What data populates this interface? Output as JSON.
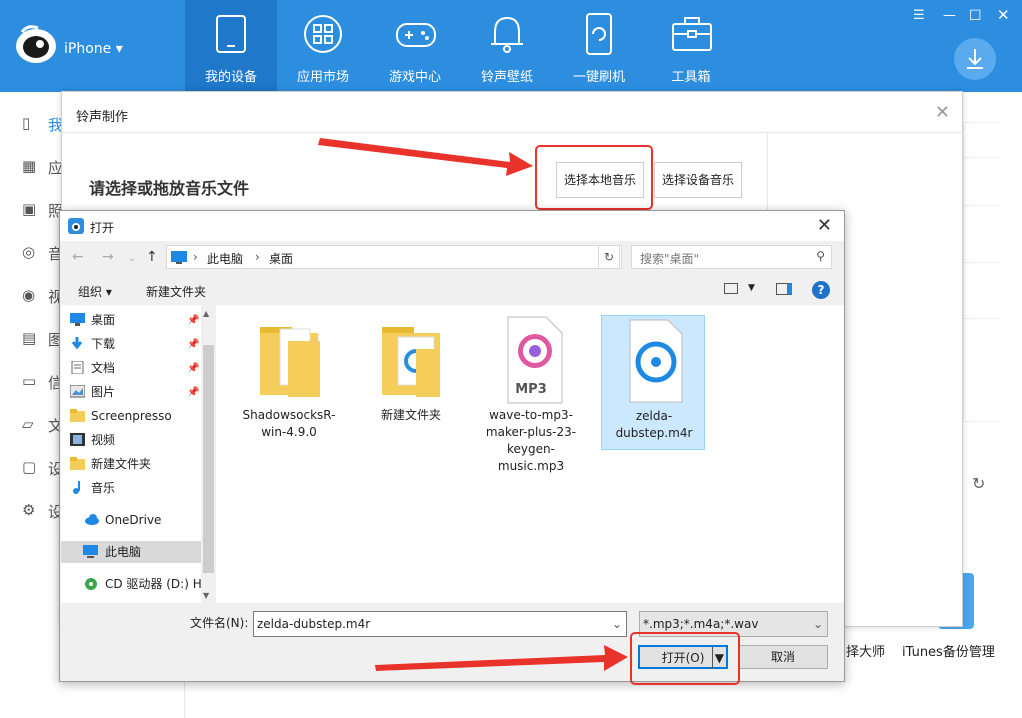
{
  "app": {
    "device": "iPhone ▾"
  },
  "nav": [
    {
      "label": "我的设备"
    },
    {
      "label": "应用市场"
    },
    {
      "label": "游戏中心"
    },
    {
      "label": "铃声壁纸"
    },
    {
      "label": "一键刷机"
    },
    {
      "label": "工具箱"
    }
  ],
  "sidebar": {
    "items": [
      {
        "label": "我"
      },
      {
        "label": "应"
      },
      {
        "label": "照"
      },
      {
        "label": "音"
      },
      {
        "label": "视"
      },
      {
        "label": "图"
      },
      {
        "label": "信"
      },
      {
        "label": "文"
      },
      {
        "label": "设"
      },
      {
        "label": "设"
      }
    ]
  },
  "bottom_labels": {
    "left": "择大师",
    "right": "iTunes备份管理"
  },
  "ringtone_dialog": {
    "title": "铃声制作",
    "prompt": "请选择或拖放音乐文件",
    "btn_local": "选择本地音乐",
    "btn_device": "选择设备音乐"
  },
  "open_dialog": {
    "title": "打开",
    "breadcrumb": [
      "此电脑",
      "桌面"
    ],
    "search_placeholder": "搜索\"桌面\"",
    "toolbar": {
      "organize": "组织 ▾",
      "new_folder": "新建文件夹"
    },
    "tree": [
      {
        "label": "桌面",
        "icon": "desktop-icon",
        "pinned": true
      },
      {
        "label": "下载",
        "icon": "download-icon",
        "pinned": true
      },
      {
        "label": "文档",
        "icon": "document-icon",
        "pinned": true
      },
      {
        "label": "图片",
        "icon": "picture-icon",
        "pinned": true
      },
      {
        "label": "Screenpresso",
        "icon": "folder-icon"
      },
      {
        "label": "视频",
        "icon": "video-icon"
      },
      {
        "label": "新建文件夹",
        "icon": "folder-icon"
      },
      {
        "label": "音乐",
        "icon": "music-icon"
      },
      {
        "label": "OneDrive",
        "icon": "cloud-icon"
      },
      {
        "label": "此电脑",
        "icon": "pc-icon",
        "selected": true
      },
      {
        "label": "CD 驱动器 (D:) H",
        "icon": "cd-icon"
      }
    ],
    "files": [
      {
        "label": "ShadowsocksR-win-4.9.0",
        "type": "folder"
      },
      {
        "label": "新建文件夹",
        "type": "folder"
      },
      {
        "label": "wave-to-mp3-maker-plus-23-keygen-music.mp3",
        "type": "mp3",
        "badge": "MP3"
      },
      {
        "label": "zelda-dubstep.m4r",
        "type": "m4r",
        "selected": true
      }
    ],
    "filename_label": "文件名(N):",
    "filename_value": "zelda-dubstep.m4r",
    "filter": "*.mp3;*.m4a;*.wav",
    "open_btn": "打开(O)",
    "cancel_btn": "取消"
  },
  "colors": {
    "topbar": "#2d8ee0",
    "active_nav": "#1f78c9",
    "highlight": "#e8322a",
    "selection": "#cce8ff"
  }
}
